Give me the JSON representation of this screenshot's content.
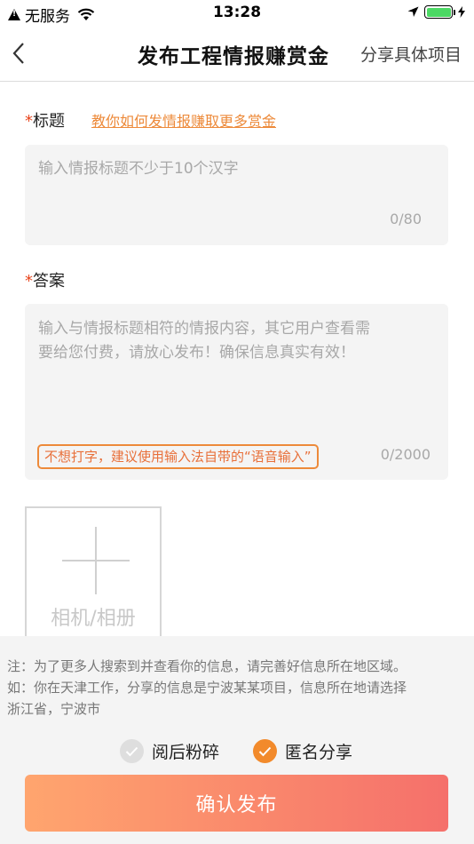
{
  "status_bar": {
    "carrier": "无服务",
    "time": "13:28"
  },
  "nav": {
    "title": "发布工程情报赚赏金",
    "right_action": "分享具体项目"
  },
  "title_field": {
    "required_mark": "*",
    "label": "标题",
    "help_link": "教你如何发情报赚取更多赏金",
    "placeholder": "输入情报标题不少于10个汉字",
    "counter": "0/80"
  },
  "answer_field": {
    "required_mark": "*",
    "label": "答案",
    "placeholder_line1": "输入与情报标题相符的情报内容，其它用户查看需",
    "placeholder_line2": "要给您付费，请放心发布！确保信息真实有效！",
    "voice_tip": "不想打字，建议使用输入法自带的“语音输入”",
    "counter": "0/2000"
  },
  "photo": {
    "label": "相机/相册"
  },
  "note": {
    "line1": "注：为了更多人搜索到并查看你的信息，请完善好信息所在地区域。",
    "line2": "如：你在天津工作，分享的信息是宁波某某项目，信息所在地请选择",
    "line3": "浙江省，宁波市"
  },
  "options": [
    {
      "label": "阅后粉碎",
      "checked": false
    },
    {
      "label": "匿名分享",
      "checked": true
    }
  ],
  "confirm_label": "确认发布",
  "colors": {
    "accent": "#ed8a3a",
    "required": "#e8461e",
    "button_start": "#ffa56e",
    "button_end": "#f5706b"
  }
}
